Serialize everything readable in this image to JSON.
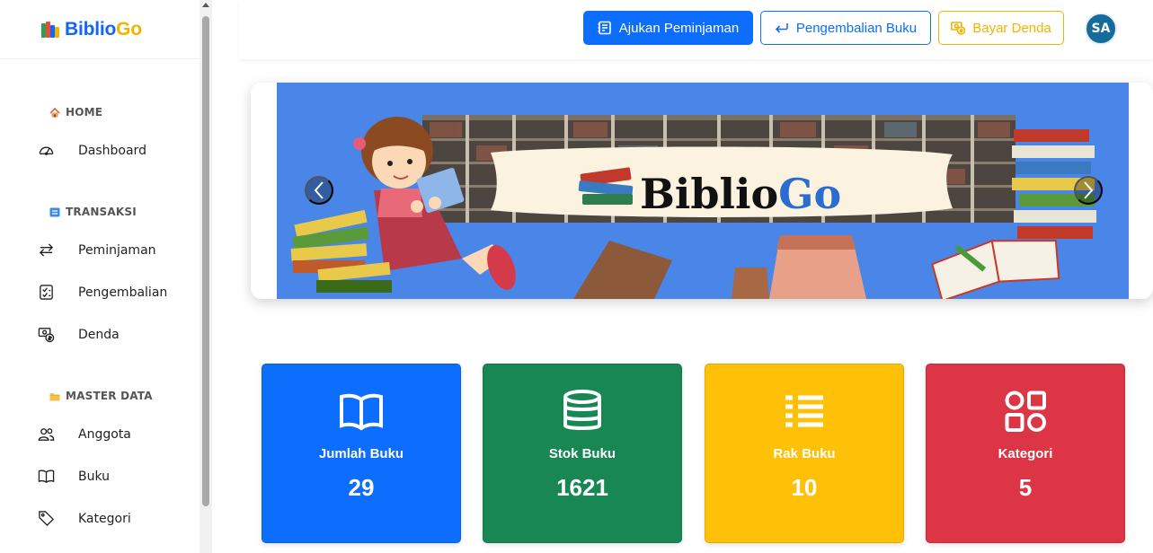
{
  "brand": {
    "part1": "Biblio",
    "part2": "Go"
  },
  "sidebar": {
    "sections": [
      {
        "title": "HOME",
        "icon": "home-icon",
        "items": [
          {
            "label": "Dashboard",
            "icon": "dashboard-gauge-icon"
          }
        ]
      },
      {
        "title": "TRANSAKSI",
        "icon": "transaction-icon",
        "items": [
          {
            "label": "Peminjaman",
            "icon": "arrows-exchange-icon"
          },
          {
            "label": "Pengembalian",
            "icon": "checklist-icon"
          },
          {
            "label": "Denda",
            "icon": "fine-cash-icon"
          }
        ]
      },
      {
        "title": "MASTER DATA",
        "icon": "folder-icon",
        "items": [
          {
            "label": "Anggota",
            "icon": "people-icon"
          },
          {
            "label": "Buku",
            "icon": "book-icon"
          },
          {
            "label": "Kategori",
            "icon": "tag-icon"
          }
        ]
      }
    ]
  },
  "topbar": {
    "borrow_label": "Ajukan Peminjaman",
    "return_label": "Pengembalian Buku",
    "fine_label": "Bayar Denda",
    "avatar_initials": "SA"
  },
  "banner": {
    "title_part1": "Biblio",
    "title_part2": "Go",
    "background_color": "#4a86e8"
  },
  "stats": [
    {
      "label": "Jumlah Buku",
      "value": "29",
      "color": "#0d6efd",
      "icon": "open-book-icon"
    },
    {
      "label": "Stok Buku",
      "value": "1621",
      "color": "#198754",
      "icon": "database-icon"
    },
    {
      "label": "Rak Buku",
      "value": "10",
      "color": "#ffc107",
      "icon": "list-columns-icon"
    },
    {
      "label": "Kategori",
      "value": "5",
      "color": "#dc3545",
      "icon": "grid-shapes-icon"
    }
  ]
}
